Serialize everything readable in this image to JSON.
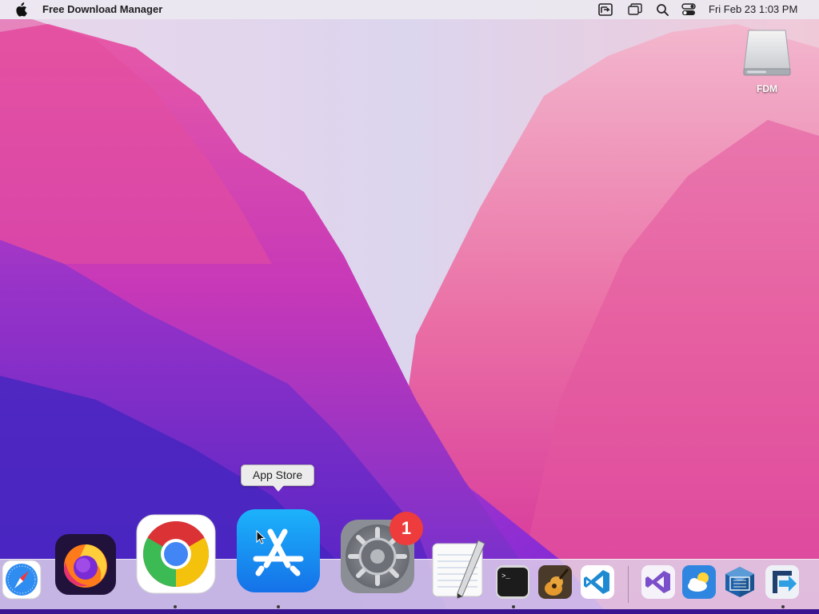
{
  "menubar": {
    "app_name": "Free Download Manager",
    "clock": "Fri Feb 23  1:03 PM",
    "icons": [
      "fdm-menubar-icon",
      "screen-mirroring-icon",
      "spotlight-search-icon",
      "control-center-icon"
    ]
  },
  "desktop": {
    "drive": {
      "label": "FDM",
      "icon": "disk-drive-icon"
    }
  },
  "tooltip": {
    "text": "App Store"
  },
  "dock": {
    "items": [
      {
        "name": "Safari",
        "icon": "safari-icon",
        "running": false
      },
      {
        "name": "Firefox",
        "icon": "firefox-icon",
        "running": false
      },
      {
        "name": "Google Chrome",
        "icon": "chrome-icon",
        "running": true
      },
      {
        "name": "App Store",
        "icon": "app-store-icon",
        "running": true
      },
      {
        "name": "System Preferences",
        "icon": "system-preferences-icon",
        "running": false,
        "badge": "1"
      },
      {
        "name": "TextEdit",
        "icon": "textedit-icon",
        "running": false
      },
      {
        "name": "Terminal",
        "icon": "terminal-icon",
        "running": true
      },
      {
        "name": "GarageBand",
        "icon": "garageband-icon",
        "running": false
      },
      {
        "name": "Visual Studio Code",
        "icon": "vscode-icon",
        "running": false
      },
      {
        "name": "Visual Studio",
        "icon": "visual-studio-icon",
        "running": false
      },
      {
        "name": "Weather",
        "icon": "weather-icon",
        "running": false
      },
      {
        "name": "VirtualBox",
        "icon": "virtualbox-icon",
        "running": false
      },
      {
        "name": "Free Download Manager",
        "icon": "fdm-icon",
        "running": true
      }
    ]
  },
  "colors": {
    "wallpaper_pink": "#e0428f",
    "wallpaper_purple": "#6a2bd0",
    "badge_red": "#ee3b3b",
    "app_store_blue": "#1a8ef5"
  }
}
